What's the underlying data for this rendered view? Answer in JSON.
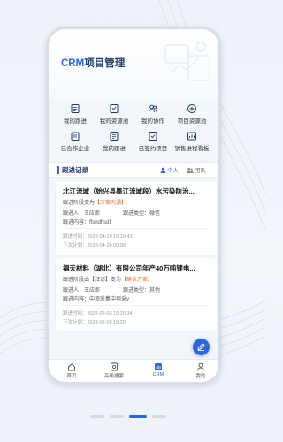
{
  "app": {
    "title_brand": "CRM",
    "title_rest": "项目管理"
  },
  "grid": [
    {
      "label": "我的跟进",
      "icon": "follow-icon"
    },
    {
      "label": "我的资源池",
      "icon": "resource-pool-icon"
    },
    {
      "label": "我的协作",
      "icon": "collaboration-icon"
    },
    {
      "label": "项目资源池",
      "icon": "project-pool-icon"
    },
    {
      "label": "已合作企业",
      "icon": "partner-company-icon"
    },
    {
      "label": "我的跟进",
      "icon": "follow-icon"
    },
    {
      "label": "已签约项目",
      "icon": "signed-project-icon"
    },
    {
      "label": "销售进程看板",
      "icon": "sales-board-icon"
    }
  ],
  "section": {
    "title": "跟进记录",
    "filter_personal": "个人",
    "filter_team": "团队"
  },
  "records": [
    {
      "title": "北江流域（始兴县墨江流域段）水污染防治...",
      "stage_prefix": "跟进阶段变为",
      "stage": "【方案沟通】",
      "person_label": "跟进人：王应郎",
      "type_label": "跟进类型：微信",
      "content_label": "跟进内容：ffshdffsdf",
      "time_label": "跟进时间：2023-04-19 15:16:43",
      "next_label": "下次计划：2023-04-26 00:00"
    },
    {
      "title": "福天材料（湖北）有限公司年产40万吨锂电...",
      "stage_prefix": "跟进阶段由【拜访】变为",
      "stage": "【确认方案】",
      "person_label": "跟进人：王应郎",
      "type_label": "跟进类型：其他",
      "content_label": "跟进内容：中项采集中项采v",
      "time_label": "跟进时间：2023-02-03 15:20:34",
      "next_label": "下次计划：2023-02-05 15:20"
    }
  ],
  "tabs": [
    {
      "label": "首页",
      "icon": "home-icon"
    },
    {
      "label": "高级搜索",
      "icon": "advanced-search-icon"
    },
    {
      "label": "CRM",
      "icon": "crm-icon"
    },
    {
      "label": "我的",
      "icon": "profile-icon"
    }
  ],
  "colors": {
    "accent": "#2d66d6",
    "title": "#1e3a66",
    "tag": "#e06a2b"
  }
}
